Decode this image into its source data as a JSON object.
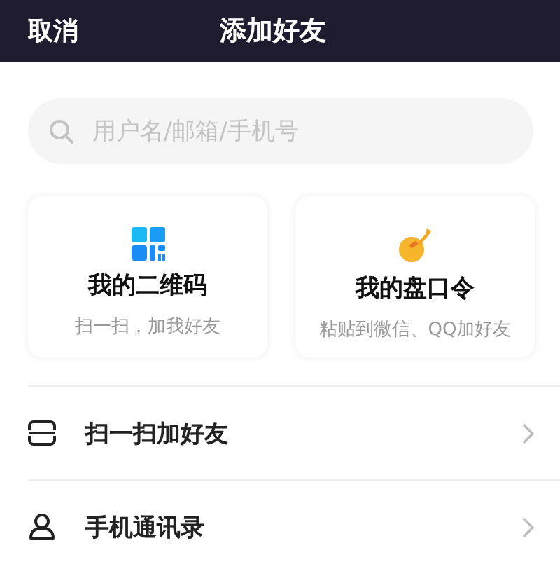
{
  "header": {
    "cancel": "取消",
    "title": "添加好友"
  },
  "search": {
    "placeholder": "用户名/邮箱/手机号"
  },
  "cards": [
    {
      "title": "我的二维码",
      "subtitle": "扫一扫，加我好友"
    },
    {
      "title": "我的盘口令",
      "subtitle": "粘贴到微信、QQ加好友"
    }
  ],
  "rows": [
    {
      "label": "扫一扫加好友"
    },
    {
      "label": "手机通讯录"
    }
  ]
}
